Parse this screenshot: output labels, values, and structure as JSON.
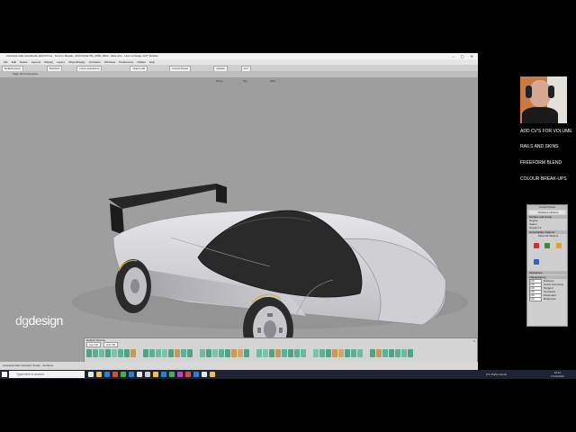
{
  "window": {
    "title": "Autodesk Alias AutoStudio 2023 Prime - Not For Resale - [NOV23 ELITE_MOD_BFA] - Alias.wire - How to Design ANY Surface",
    "window_controls": "– ▢ ✕"
  },
  "menu": [
    "File",
    "Edit",
    "Delete",
    "Layouts",
    "Display",
    "Layers",
    "ObjectDisplay",
    "Animation",
    "Windows",
    "Preferences",
    "Utilities",
    "Help"
  ],
  "shelf_tabs": [
    "Default panel",
    "Surfaces",
    "curve operations",
    "object edit",
    "Control Panel",
    "surface",
    "surf"
  ],
  "toolbar": {
    "label": "Page 3D Perspective"
  },
  "viewport": {
    "buttons": [
      "Persp",
      "Top",
      "Side"
    ],
    "logo_part1": "dg",
    "logo_part2": "design"
  },
  "palette": {
    "title": "Default Shelves",
    "tabs": [
      "Surf 2D",
      "Surf 3D"
    ],
    "close": "×"
  },
  "status": {
    "text": "Autodesk Alias Software Studio - Surfaces"
  },
  "control_window": {
    "title": "Control Panel",
    "subtitle": "Surfaces Options",
    "sections": [
      {
        "name": "Surface and Curve",
        "rows": [
          "Degree",
          "Spans",
          "Isoparm #"
        ]
      },
      {
        "name": "Construction Options",
        "rows": [
          "Show All Objects"
        ]
      },
      {
        "name": "Operations",
        "rows": []
      },
      {
        "name": "Transparency",
        "rows": []
      }
    ],
    "fields": [
      {
        "value": "0.00",
        "label": "Distance"
      },
      {
        "value": "0.00",
        "label": "Curve Continuity"
      },
      {
        "value": "0.00",
        "label": "Tangent"
      },
      {
        "value": "0.00",
        "label": "Curvature"
      },
      {
        "value": "0.00",
        "label": "Parameter"
      },
      {
        "value": "0.00",
        "label": "Reference"
      }
    ]
  },
  "webcam": {
    "visible": true
  },
  "right_notes": [
    "ADD CV'S FOR VOLUME",
    "RAILS AND SKINS",
    "FREEFORM BLEND",
    "COLOUR BREAK-UPS"
  ],
  "taskbar": {
    "search_placeholder": "Type here to search",
    "tray_text": "9°C  Partly cloudy",
    "time": "10:42",
    "date": "17/11/2023"
  },
  "colors": {
    "viewport_bg": "#9e9e9e",
    "car_body": "#d8d8dc",
    "canopy": "#2a2a2a",
    "tire": "#2b2b2b",
    "tire_text": "#e0b020",
    "taskbar_bg": "#1c2431"
  },
  "icons": [
    "windows-start-icon",
    "search-icon",
    "task-view-icon",
    "file-explorer-icon",
    "edge-icon",
    "chrome-icon",
    "alias-icon",
    "mail-icon",
    "settings-icon"
  ]
}
